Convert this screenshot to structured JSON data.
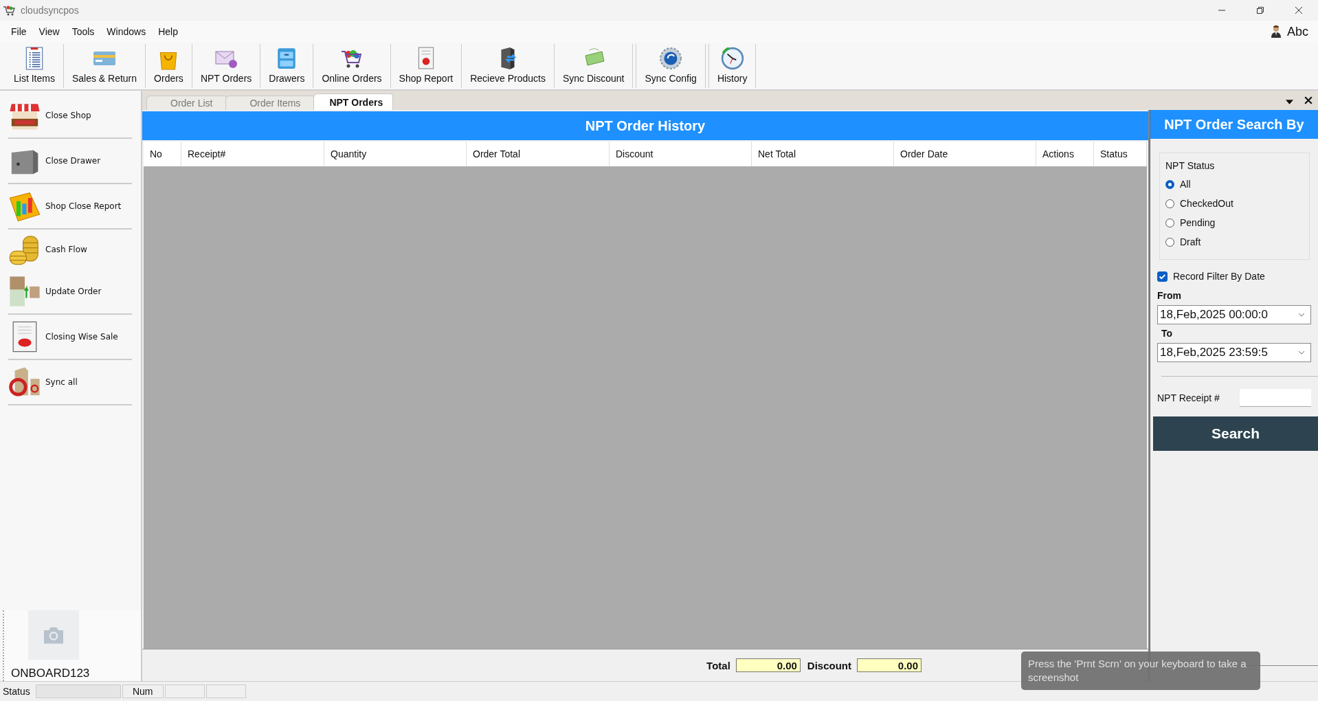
{
  "window": {
    "title": "cloudsyncpos"
  },
  "menu": [
    "File",
    "View",
    "Tools",
    "Windows",
    "Help"
  ],
  "user": {
    "name": "Abc"
  },
  "toolbar": [
    "List Items",
    "Sales & Return",
    "Orders",
    "NPT Orders",
    "Drawers",
    "Online Orders",
    "Shop Report",
    "Recieve Products",
    "Sync Discount",
    "Sync Config",
    "History"
  ],
  "sidebar": {
    "items": [
      "Close Shop",
      "Close Drawer",
      "Shop Close Report",
      "Cash Flow",
      "Update Order",
      "Closing Wise Sale",
      "Sync all"
    ],
    "profile": {
      "name": "ONBOARD123"
    }
  },
  "tabs": [
    {
      "label": "Order List",
      "selected": false
    },
    {
      "label": "Order Items",
      "selected": false
    },
    {
      "label": "NPT Orders",
      "selected": true
    }
  ],
  "grid": {
    "title": "NPT Order History",
    "columns": [
      "No",
      "Receipt#",
      "Quantity",
      "Order Total",
      "Discount",
      "Net Total",
      "Order Date",
      "Actions",
      "Status"
    ]
  },
  "totals": [
    {
      "label": "Total",
      "value": "0.00"
    },
    {
      "label": "Discount",
      "value": "0.00"
    }
  ],
  "search_panel": {
    "title": "NPT Order Search By",
    "status_group": {
      "label": "NPT Status",
      "options": [
        {
          "label": "All",
          "selected": true
        },
        {
          "label": "CheckedOut",
          "selected": false
        },
        {
          "label": "Pending",
          "selected": false
        },
        {
          "label": "Draft",
          "selected": false
        }
      ]
    },
    "date_filter": {
      "label": "Record Filter By Date",
      "checked": true
    },
    "from": {
      "label": "From",
      "value": "18,Feb,2025  00:00:0"
    },
    "to": {
      "label": "To",
      "value": "18,Feb,2025  23:59:5"
    },
    "receipt": {
      "label": "NPT Receipt #"
    },
    "button": "Search"
  },
  "status_bar": {
    "label": "Status",
    "num": "Num"
  },
  "toast": {
    "text": "Press the 'Prnt Scrn' on your keyboard to take a screenshot"
  }
}
